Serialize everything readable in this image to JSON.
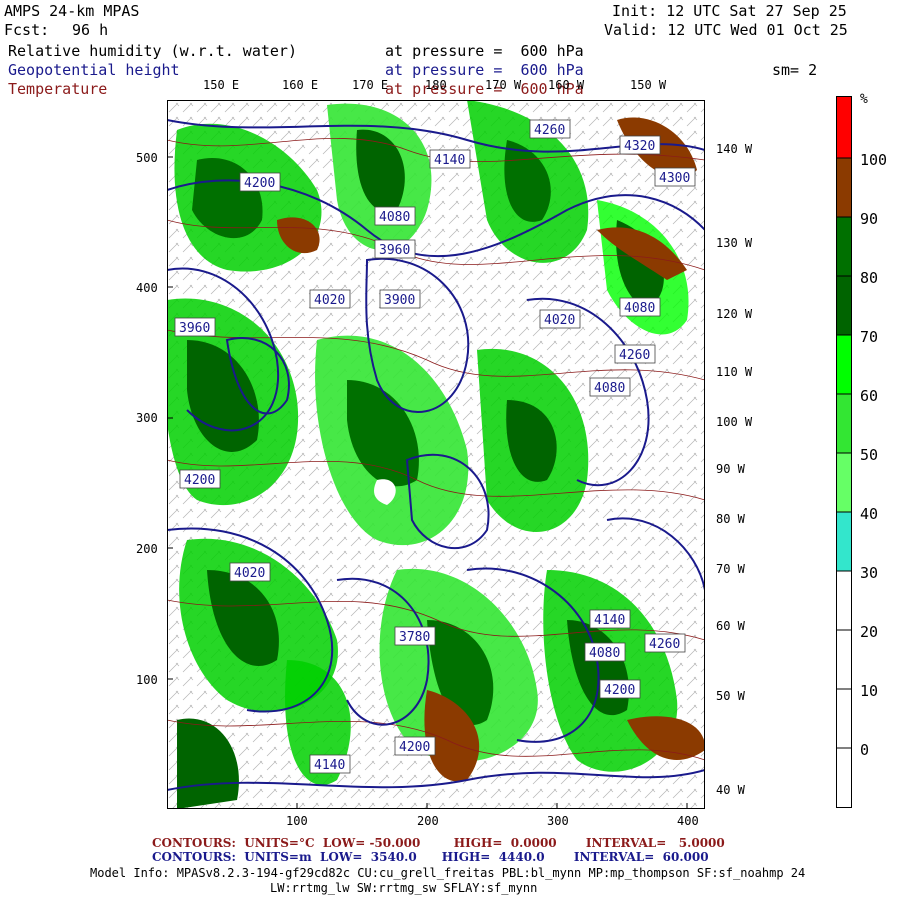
{
  "header": {
    "model": "AMPS 24-km MPAS",
    "fcst_label": "Fcst:",
    "fcst_value": "96 h",
    "init": "Init: 12 UTC Sat 27 Sep 25",
    "valid": "Valid: 12 UTC Wed 01 Oct 25"
  },
  "fields": [
    {
      "name": "Relative humidity (w.r.t. water)",
      "level": "at pressure =  600 hPa",
      "color": "#000000"
    },
    {
      "name": "Geopotential height",
      "level": "at pressure =  600 hPa",
      "color": "#1a1a8c"
    },
    {
      "name": "Temperature",
      "level": "at pressure =  600 hPa",
      "color": "#8b1a1a"
    }
  ],
  "smoothing": "sm= 2",
  "top_lon_labels": [
    "150 E",
    "160 E",
    "170 E",
    "180",
    "170 W",
    "160 W",
    "150 W"
  ],
  "right_lon_labels": [
    "140 W",
    "130 W",
    "120 W",
    "110 W",
    "100 W",
    "90 W",
    "80 W",
    "70 W",
    "60 W",
    "50 W",
    "40 W"
  ],
  "y_ticks": [
    "500",
    "400",
    "300",
    "200",
    "100"
  ],
  "x_ticks": [
    "100",
    "200",
    "300",
    "400"
  ],
  "height_contour_labels": [
    "4260",
    "4320",
    "4300",
    "4140",
    "4200",
    "4080",
    "3960",
    "4020",
    "3900",
    "4080",
    "4020",
    "3960",
    "4260",
    "4080",
    "4200",
    "4020",
    "3780",
    "4140",
    "4260",
    "4080",
    "4200",
    "4140",
    "4200"
  ],
  "colorbar": {
    "unit": "%",
    "labels": [
      "100",
      "90",
      "80",
      "70",
      "60",
      "50",
      "40",
      "30",
      "20",
      "10",
      "0"
    ],
    "colors": [
      "#ff0000",
      "#8b3a00",
      "#007000",
      "#006400",
      "#00ff00",
      "#33e633",
      "#66ff66",
      "#33e6cc",
      "#ffffff",
      "#ffffff",
      "#ffffff",
      "#ffffff"
    ]
  },
  "footer": {
    "temp_contours": "CONTOURS:  UNITS=°C  LOW= -50.000        HIGH=  0.0000       INTERVAL=   5.0000",
    "height_contours": "CONTOURS:  UNITS=m  LOW=  3540.0      HIGH=  4440.0       INTERVAL=  60.000",
    "model_info": "Model Info: MPASv8.2.3-194-gf29cd82c CU:cu_grell_freitas PBL:bl_mynn MP:mp_thompson SF:sf_noahmp 24",
    "model_info_2": "LW:rrtmg_lw SW:rrtmg_sw SFLAY:sf_mynn"
  }
}
